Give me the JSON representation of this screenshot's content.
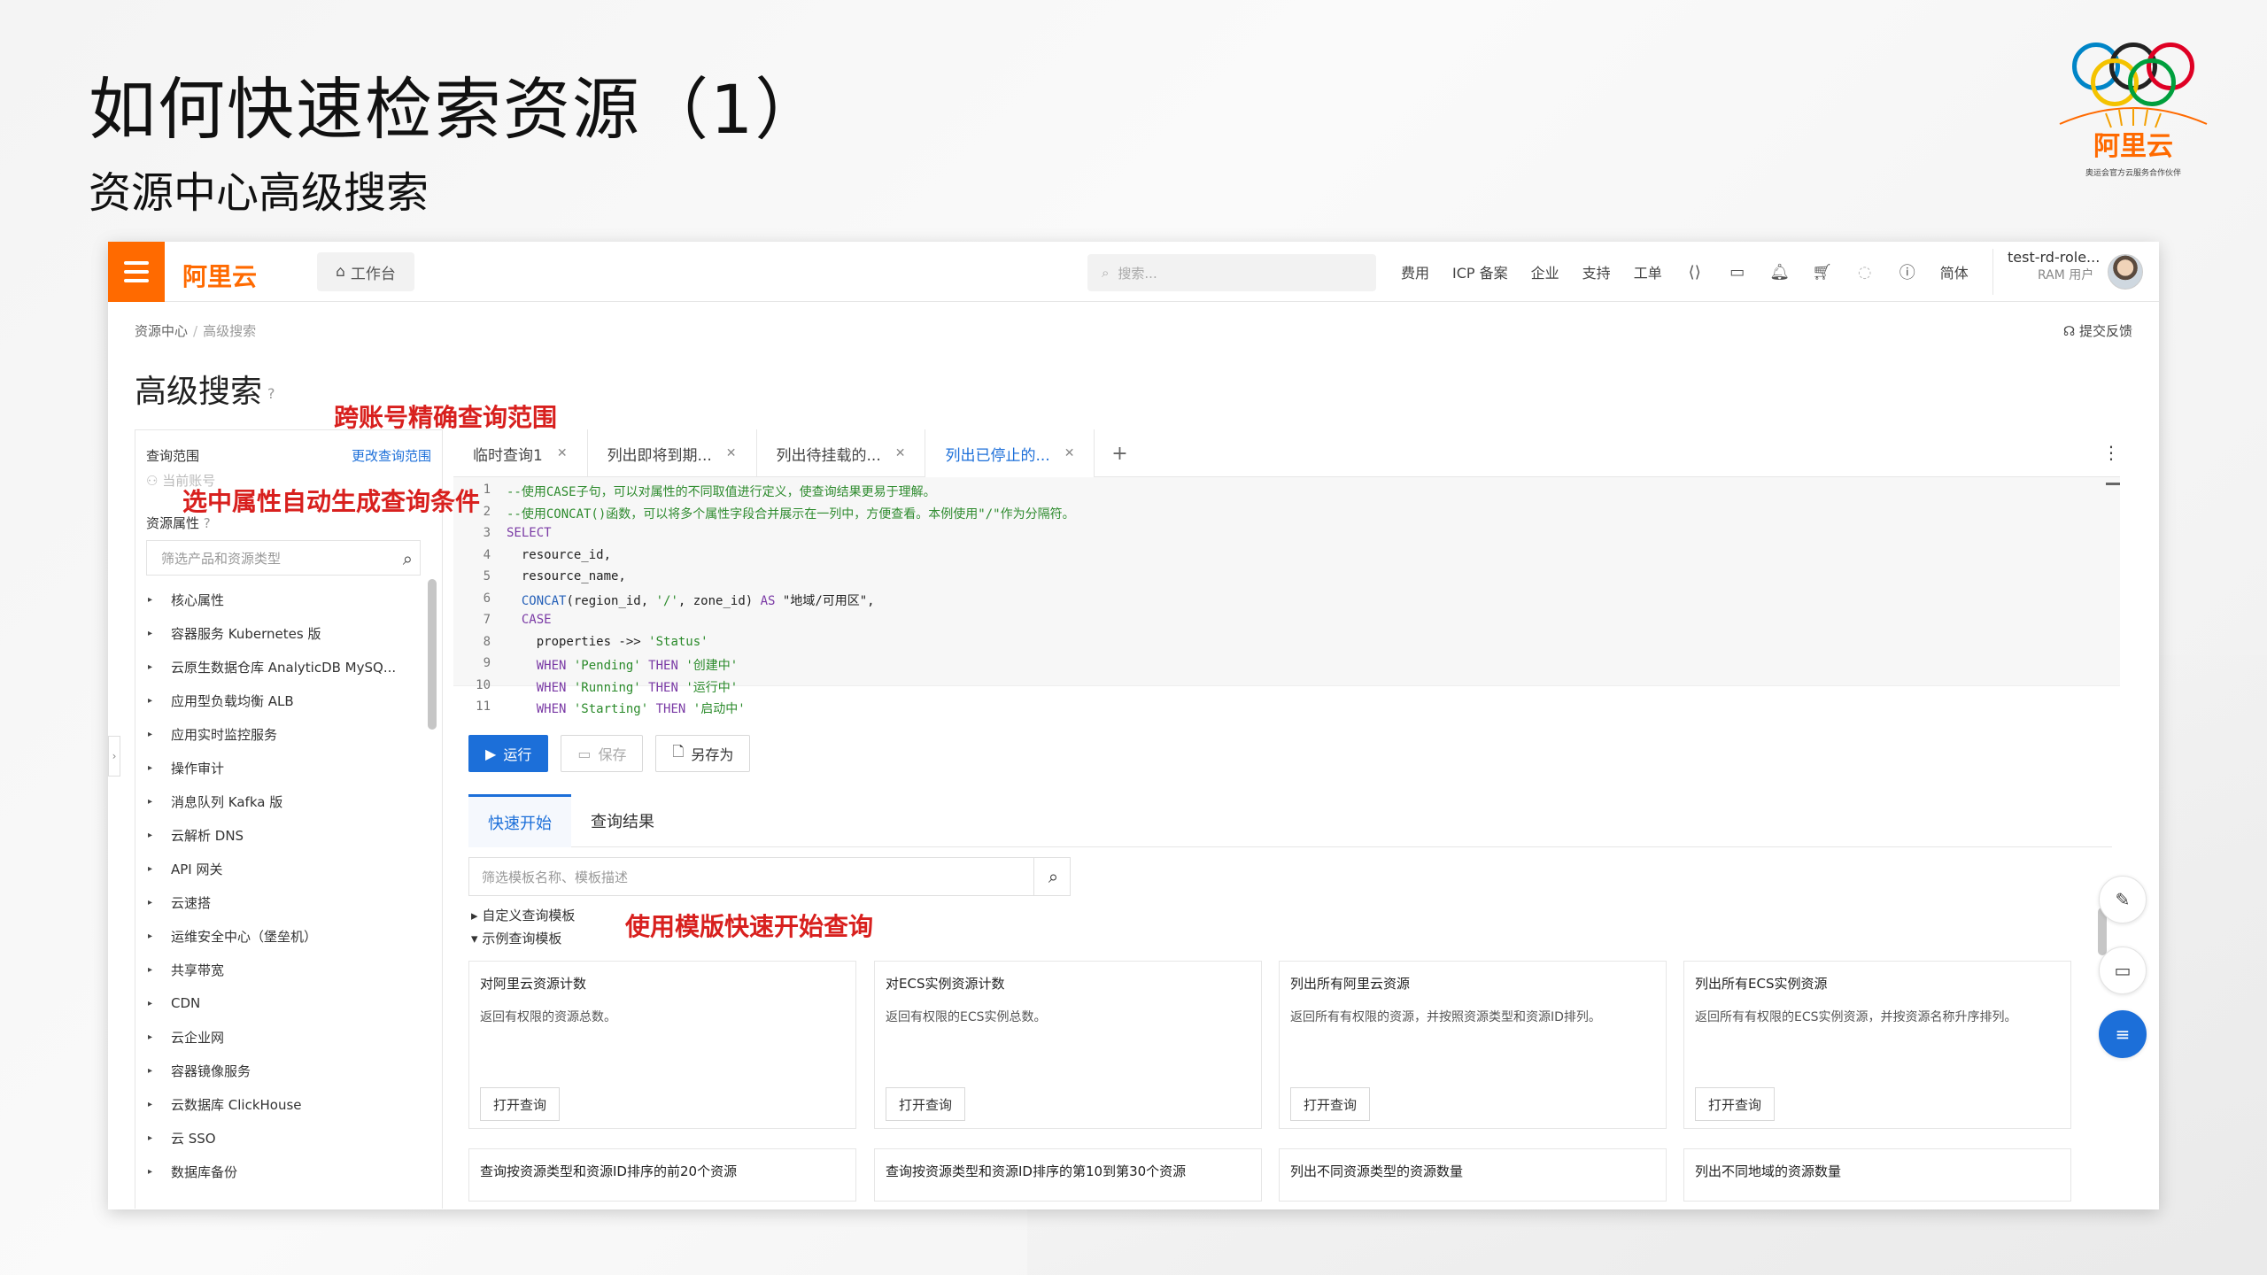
{
  "slide": {
    "title": "如何快速检索资源（1）",
    "subtitle": "资源中心高级搜索",
    "logo_brand": "阿里云",
    "logo_slogan": "奥运会官方云服务合作伙伴"
  },
  "topbar": {
    "brand": "阿里云",
    "workbench": "工作台",
    "search_placeholder": "搜索...",
    "nav": [
      "费用",
      "ICP 备案",
      "企业",
      "支持",
      "工单"
    ],
    "lang": "简体",
    "user_name": "test-rd-role...",
    "user_role": "RAM 用户"
  },
  "page": {
    "breadcrumb": [
      "资源中心",
      "高级搜索"
    ],
    "feedback": "提交反馈",
    "heading": "高级搜索"
  },
  "annotations": {
    "cross_account": "跨账号精确查询范围",
    "auto_condition": "选中属性自动生成查询条件",
    "template_start": "使用模版快速开始查询"
  },
  "left_panel": {
    "scope_label": "查询范围",
    "scope_change": "更改查询范围",
    "account": "当前账号",
    "attr_label": "资源属性",
    "filter_placeholder": "筛选产品和资源类型",
    "items": [
      "核心属性",
      "容器服务 Kubernetes 版",
      "云原生数据仓库 AnalyticDB MySQ...",
      "应用型负载均衡 ALB",
      "应用实时监控服务",
      "操作审计",
      "消息队列 Kafka 版",
      "云解析 DNS",
      "API 网关",
      "云速搭",
      "运维安全中心（堡垒机）",
      "共享带宽",
      "CDN",
      "云企业网",
      "容器镜像服务",
      "云数据库 ClickHouse",
      "云 SSO",
      "数据库备份"
    ]
  },
  "tabs": [
    {
      "label": "临时查询1",
      "active": false
    },
    {
      "label": "列出即将到期...",
      "active": false
    },
    {
      "label": "列出待挂载的...",
      "active": false
    },
    {
      "label": "列出已停止的...",
      "active": true
    }
  ],
  "editor": {
    "line_numbers": [
      "1",
      "2",
      "3",
      "4",
      "5",
      "6",
      "7",
      "8",
      "9",
      "10",
      "11"
    ]
  },
  "buttons": {
    "run": "运行",
    "save": "保存",
    "save_as": "另存为"
  },
  "sub_tabs": [
    "快速开始",
    "查询结果"
  ],
  "templates": {
    "search_placeholder": "筛选模板名称、模板描述",
    "tree": [
      "自定义查询模板",
      "示例查询模板"
    ],
    "open_label": "打开查询",
    "cards": [
      {
        "title": "对阿里云资源计数",
        "desc": "返回有权限的资源总数。"
      },
      {
        "title": "对ECS实例资源计数",
        "desc": "返回有权限的ECS实例总数。"
      },
      {
        "title": "列出所有阿里云资源",
        "desc": "返回所有有权限的资源，并按照资源类型和资源ID排列。"
      },
      {
        "title": "列出所有ECS实例资源",
        "desc": "返回所有有权限的ECS实例资源，并按资源名称升序排列。"
      }
    ],
    "cards_row2": [
      "查询按资源类型和资源ID排序的前20个资源",
      "查询按资源类型和资源ID排序的第10到第30个资源",
      "列出不同资源类型的资源数量",
      "列出不同地域的资源数量"
    ]
  }
}
